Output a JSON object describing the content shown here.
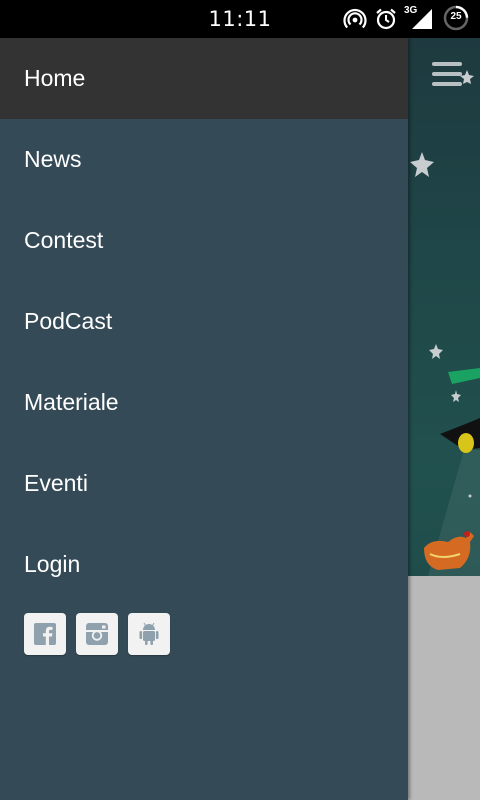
{
  "status_bar": {
    "time": "11:11",
    "network_label": "3G",
    "battery_level": "25"
  },
  "drawer": {
    "items": [
      {
        "label": "Home",
        "active": true
      },
      {
        "label": "News"
      },
      {
        "label": "Contest"
      },
      {
        "label": "PodCast"
      },
      {
        "label": "Materiale"
      },
      {
        "label": "Eventi"
      },
      {
        "label": "Login"
      }
    ],
    "social": [
      "facebook-icon",
      "instagram-icon",
      "android-icon"
    ]
  },
  "colors": {
    "drawer_bg": "#354a57",
    "active_item_bg": "#333333",
    "statusbar_bg": "#000000",
    "social_icon": "#8fa1ad"
  }
}
